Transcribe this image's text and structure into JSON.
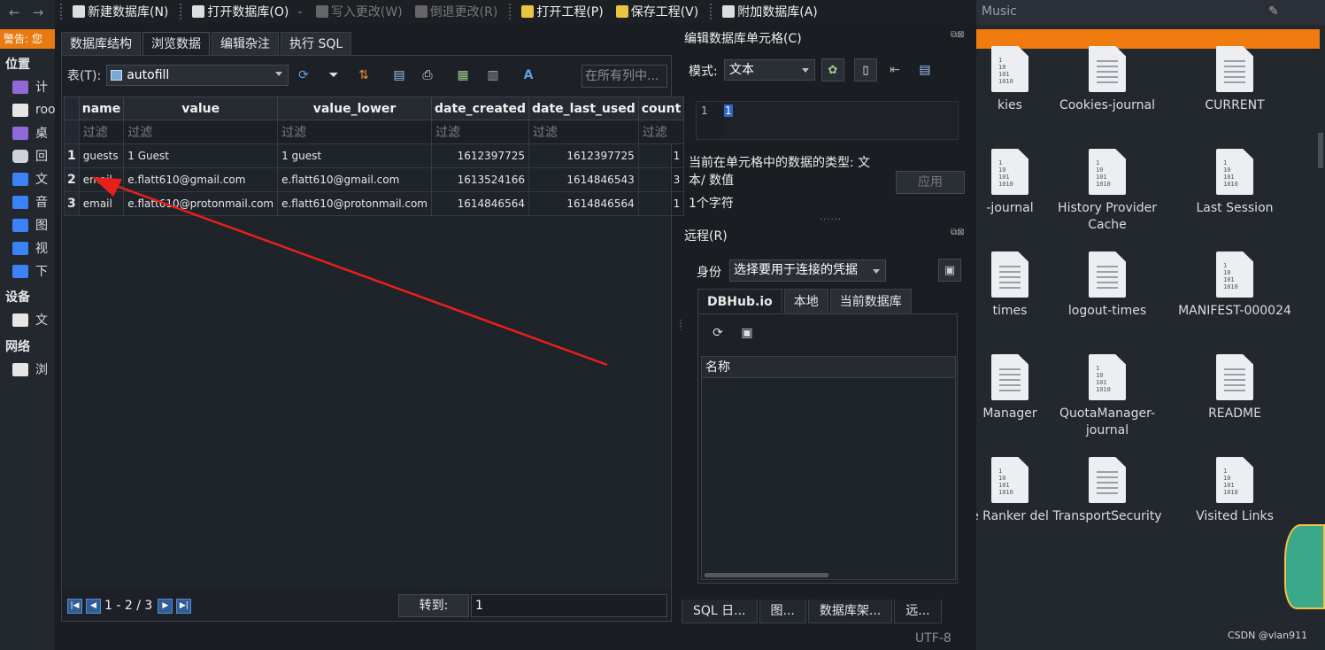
{
  "file_manager": {
    "left": {
      "nav": {
        "back": "←",
        "forward": "→"
      },
      "warning": "警告: 您",
      "sections": {
        "places": "位置",
        "devices": "设备",
        "network": "网络"
      },
      "places": [
        {
          "label": "计",
          "icon": "computer-icon"
        },
        {
          "label": "roo",
          "icon": "home-folder-icon"
        },
        {
          "label": "桌",
          "icon": "desktop-icon"
        },
        {
          "label": "回",
          "icon": "trash-icon"
        },
        {
          "label": "文",
          "icon": "folder-icon"
        },
        {
          "label": "音",
          "icon": "folder-icon"
        },
        {
          "label": "图",
          "icon": "folder-icon"
        },
        {
          "label": "视",
          "icon": "folder-icon"
        },
        {
          "label": "下",
          "icon": "download-folder-icon"
        }
      ],
      "devices": [
        {
          "label": "文",
          "icon": "drive-icon"
        }
      ],
      "network": [
        {
          "label": "浏",
          "icon": "network-icon"
        }
      ]
    },
    "right": {
      "breadcrumb": "Music",
      "files": [
        {
          "name": "kies",
          "type": "binary"
        },
        {
          "name": "Cookies-journal",
          "type": "text"
        },
        {
          "name": "CURRENT",
          "type": "text"
        },
        {
          "name": "-journal",
          "type": "binary"
        },
        {
          "name": "History Provider Cache",
          "type": "binary"
        },
        {
          "name": "Last Session",
          "type": "binary"
        },
        {
          "name": "times",
          "type": "text"
        },
        {
          "name": "logout-times",
          "type": "text"
        },
        {
          "name": "MANIFEST-000024",
          "type": "binary"
        },
        {
          "name": "Manager",
          "type": "text"
        },
        {
          "name": "QuotaManager-journal",
          "type": "binary"
        },
        {
          "name": "README",
          "type": "text"
        },
        {
          "name": "e Ranker del",
          "type": "binary"
        },
        {
          "name": "TransportSecurity",
          "type": "text"
        },
        {
          "name": "Visited Links",
          "type": "binary"
        }
      ],
      "watermark": "CSDN @vlan911"
    }
  },
  "toolbar": {
    "new_db": "新建数据库(N)",
    "open_db": "打开数据库(O)",
    "write_changes": "写入更改(W)",
    "revert_changes": "倒退更改(R)",
    "open_project": "打开工程(P)",
    "save_project": "保存工程(V)",
    "attach_db": "附加数据库(A)"
  },
  "main_tabs": [
    "数据库结构",
    "浏览数据",
    "编辑杂注",
    "执行 SQL"
  ],
  "active_tab": 1,
  "browse": {
    "table_label": "表(T):",
    "table_name": "autofill",
    "search_placeholder": "在所有列中...",
    "columns": [
      "name",
      "value",
      "value_lower",
      "date_created",
      "date_last_used",
      "count"
    ],
    "filter_placeholder": "过滤",
    "rows": [
      {
        "n": "1",
        "cells": [
          "guests",
          "1 Guest",
          "1 guest",
          "1612397725",
          "1612397725",
          "1"
        ]
      },
      {
        "n": "2",
        "cells": [
          "email",
          "e.flatt610@gmail.com",
          "e.flatt610@gmail.com",
          "1613524166",
          "1614846543",
          "3"
        ]
      },
      {
        "n": "3",
        "cells": [
          "email",
          "e.flatt610@protonmail.com",
          "e.flatt610@protonmail.com",
          "1614846564",
          "1614846564",
          "1"
        ]
      }
    ],
    "pagination": "1 - 2 / 3",
    "goto_label": "转到:",
    "goto_value": "1"
  },
  "edit_cell": {
    "title": "编辑数据库单元格(C)",
    "mode_label": "模式:",
    "mode_value": "文本",
    "line_number": "1",
    "content": "1",
    "type_text": "当前在单元格中的数据的类型: 文本/ 数值",
    "apply": "应用",
    "char_count": "1个字符"
  },
  "remote": {
    "title": "远程(R)",
    "identity_label": "身份",
    "identity_value": "选择要用于连接的凭据",
    "tabs": [
      "DBHub.io",
      "本地",
      "当前数据库"
    ],
    "column_name": "名称"
  },
  "bottom_tabs": [
    "SQL 日...",
    "图...",
    "数据库架...",
    "远..."
  ],
  "status": {
    "encoding": "UTF-8"
  },
  "colors": {
    "accent": "#2e67c8",
    "warning": "#f07c10",
    "arrow": "#e8201a"
  }
}
